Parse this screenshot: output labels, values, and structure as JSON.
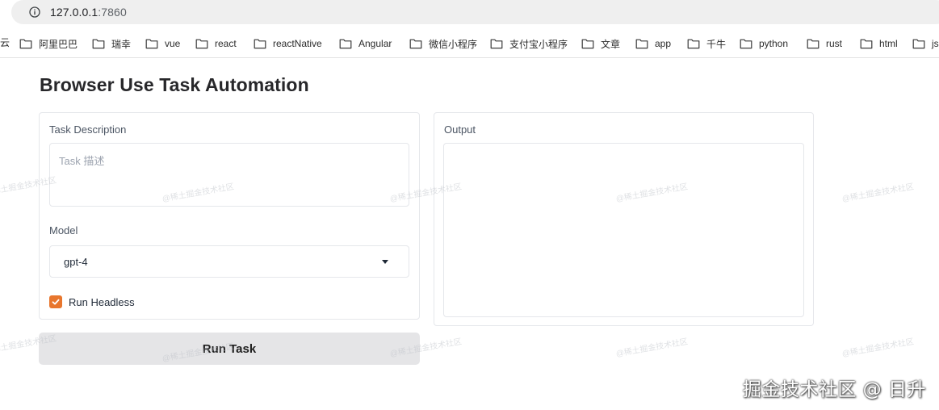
{
  "browser": {
    "url_host": "127.0.0.1",
    "url_port": ":7860",
    "bookmark_cut": "云",
    "bookmarks": [
      "阿里巴巴",
      "瑞幸",
      "vue",
      "react",
      "reactNative",
      "Angular",
      "微信小程序",
      "支付宝小程序",
      "文章",
      "app",
      "千牛",
      "python",
      "rust",
      "html",
      "js"
    ]
  },
  "app": {
    "title": "Browser Use Task Automation",
    "task": {
      "label": "Task Description",
      "placeholder": "Task 描述",
      "value": ""
    },
    "model": {
      "label": "Model",
      "value": "gpt-4"
    },
    "headless": {
      "label": "Run Headless",
      "checked": true
    },
    "run_button": "Run Task",
    "output": {
      "label": "Output",
      "value": ""
    }
  },
  "watermark": {
    "repeat": "@稀土掘金技术社区",
    "footer": "掘金技术社区 @ 日升"
  },
  "colors": {
    "accent": "#e8762d",
    "button_bg": "#e5e5e7",
    "border": "#e5e7eb"
  }
}
